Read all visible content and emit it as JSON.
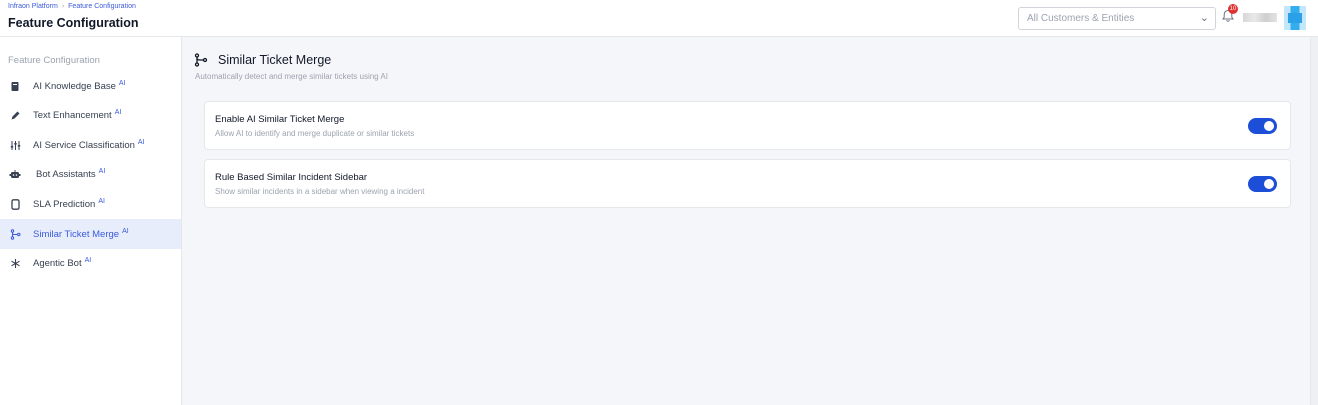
{
  "header": {
    "breadcrumb": [
      "Infraon Platform",
      "Feature Configuration"
    ],
    "breadcrumb_sep": "›",
    "title": "Feature Configuration",
    "scope_select": {
      "placeholder": "All Customers & Entities",
      "chevron": "⌄"
    },
    "notification_count": "10"
  },
  "sidebar": {
    "heading": "Feature Configuration",
    "ai_tag": "AI",
    "items": [
      {
        "label": "AI Knowledge Base",
        "icon": "book-icon",
        "ai": true,
        "active": false
      },
      {
        "label": "Text Enhancement",
        "icon": "pencil-icon",
        "ai": true,
        "active": false
      },
      {
        "label": "AI Service Classification",
        "icon": "sliders-icon",
        "ai": true,
        "active": false
      },
      {
        "label": "Bot Assistants",
        "icon": "robot-icon",
        "ai": true,
        "active": false
      },
      {
        "label": "SLA Prediction",
        "icon": "device-icon",
        "ai": true,
        "active": false
      },
      {
        "label": "Similar Ticket Merge",
        "icon": "merge-icon",
        "ai": true,
        "active": true
      },
      {
        "label": "Agentic Bot",
        "icon": "snowflake-icon",
        "ai": true,
        "active": false
      }
    ]
  },
  "main": {
    "title": "Similar Ticket Merge",
    "subtitle": "Automatically detect and merge similar tickets using AI",
    "settings": [
      {
        "title": "Enable AI Similar Ticket Merge",
        "description": "Allow AI to identify and merge duplicate or similar tickets",
        "enabled": true
      },
      {
        "title": "Rule Based Similar Incident Sidebar",
        "description": "Show similar incidents in a sidebar when viewing a incident",
        "enabled": true
      }
    ]
  },
  "colors": {
    "accent": "#1d4ed8",
    "link": "#3b5bdb",
    "active_bg": "#e8edfb"
  }
}
